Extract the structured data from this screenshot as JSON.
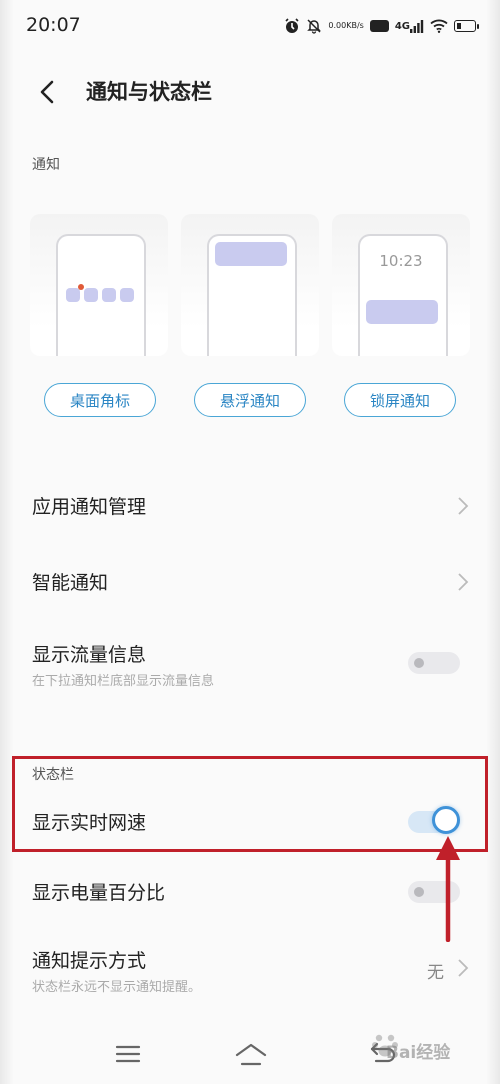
{
  "status_bar": {
    "time": "20:07",
    "net_speed_value": "0.00",
    "net_speed_unit": "KB/s",
    "hd_label": "HD",
    "network_label": "4G",
    "icons": [
      "alarm-icon",
      "mute-bell-icon",
      "signal-icon",
      "wifi-icon",
      "battery-icon"
    ]
  },
  "header": {
    "title": "通知与状态栏",
    "back_icon": "chevron-left-icon"
  },
  "notifications_section": {
    "label": "通知",
    "lock_screen_time": "10:23",
    "buttons": [
      "桌面角标",
      "悬浮通知",
      "锁屏通知"
    ]
  },
  "rows": {
    "app_notification_management": {
      "title": "应用通知管理"
    },
    "smart_notification": {
      "title": "智能通知"
    },
    "show_data_usage": {
      "title": "显示流量信息",
      "subtitle": "在下拉通知栏底部显示流量信息",
      "enabled": false
    },
    "show_network_speed": {
      "title": "显示实时网速",
      "enabled": true
    },
    "show_battery_percentage": {
      "title": "显示电量百分比",
      "enabled": false
    },
    "notification_style": {
      "title": "通知提示方式",
      "subtitle": "状态栏永远不显示通知提醒。",
      "value": "无"
    }
  },
  "status_bar_section": {
    "label": "状态栏"
  },
  "colors": {
    "accent": "#3f92d8",
    "pill_border": "#4aa6d6",
    "highlight": "#c0202a",
    "preview_fill": "#c9cbef"
  },
  "nav_bar": {
    "icons": [
      "menu-icon",
      "home-icon",
      "back-nav-icon"
    ]
  },
  "watermark": {
    "text": "Bai经验"
  }
}
